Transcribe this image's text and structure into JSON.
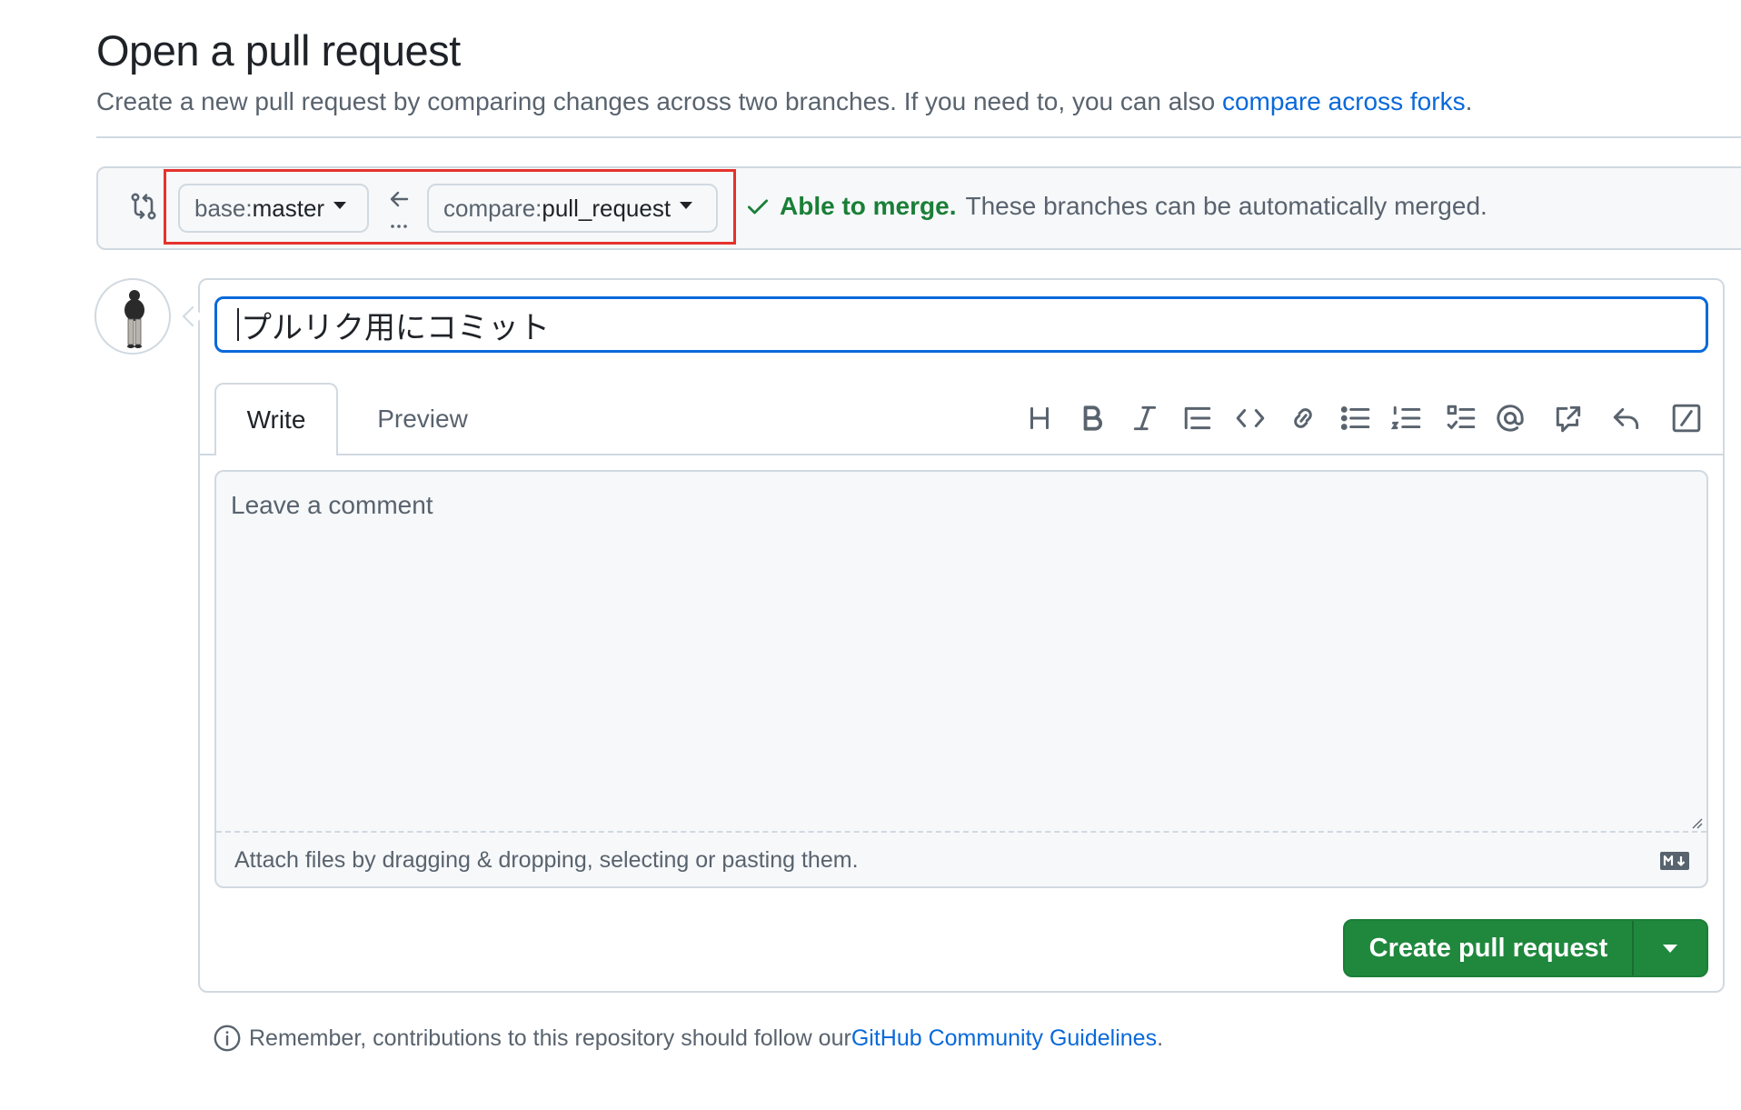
{
  "page": {
    "title": "Open a pull request",
    "description_prefix": "Create a new pull request by comparing changes across two branches. If you need to, you can also ",
    "description_link": "compare across forks",
    "description_suffix": "."
  },
  "range": {
    "base_prefix": "base: ",
    "base_branch": "master",
    "compare_prefix": "compare: ",
    "compare_branch": "pull_request",
    "merge_ok_label": "Able to merge.",
    "merge_detail": "These branches can be automatically merged."
  },
  "composer": {
    "title_value": "プルリク用にコミット",
    "tabs": [
      "Write",
      "Preview"
    ],
    "active_tab": "Write",
    "toolbar_icons": [
      "heading-icon",
      "bold-icon",
      "italic-icon",
      "quote-icon",
      "code-icon",
      "link-icon",
      "bulleted-list-icon",
      "numbered-list-icon",
      "task-list-icon",
      "mention-icon",
      "reference-icon",
      "reply-icon",
      "slash-command-icon"
    ],
    "comment_placeholder": "Leave a comment",
    "attach_text": "Attach files by dragging & dropping, selecting or pasting them.",
    "submit_label": "Create pull request"
  },
  "footer": {
    "prefix": "Remember, contributions to this repository should follow our ",
    "link": "GitHub Community Guidelines",
    "suffix": "."
  },
  "colors": {
    "link": "#0969da",
    "success": "#1a7f37",
    "primary_button": "#1f883d",
    "focus": "#0969da",
    "highlight_box": "#e5322d"
  }
}
